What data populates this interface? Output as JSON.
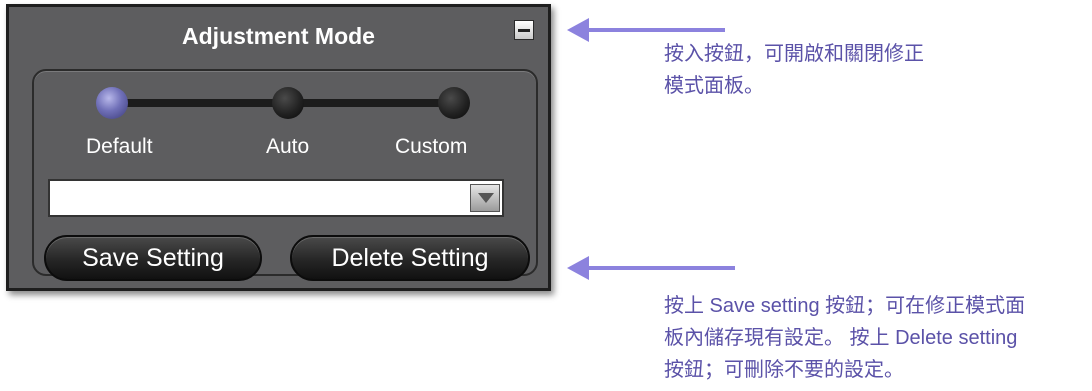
{
  "panel": {
    "title": "Adjustment Mode",
    "mode_options": [
      "Default",
      "Auto",
      "Custom"
    ],
    "selected_mode": "Default",
    "preset_value": "",
    "save_label": "Save Setting",
    "delete_label": "Delete Setting"
  },
  "annotations": {
    "toggle_line1": "按入按鈕，可開啟和關閉修正",
    "toggle_line2": "模式面板。",
    "save_line1": "按上 Save setting 按鈕；可在修正模式面",
    "save_line2": "板內儲存現有設定。 按上 Delete setting",
    "save_line3": "按鈕；可刪除不要的設定。"
  },
  "colors": {
    "panel_bg": "#5d5d5f",
    "active_knob": "#7070b8",
    "arrow": "#8c82de",
    "note_text": "#5b52a8"
  },
  "icons": {
    "minimize": "minimize-icon",
    "dropdown": "chevron-down-icon"
  }
}
